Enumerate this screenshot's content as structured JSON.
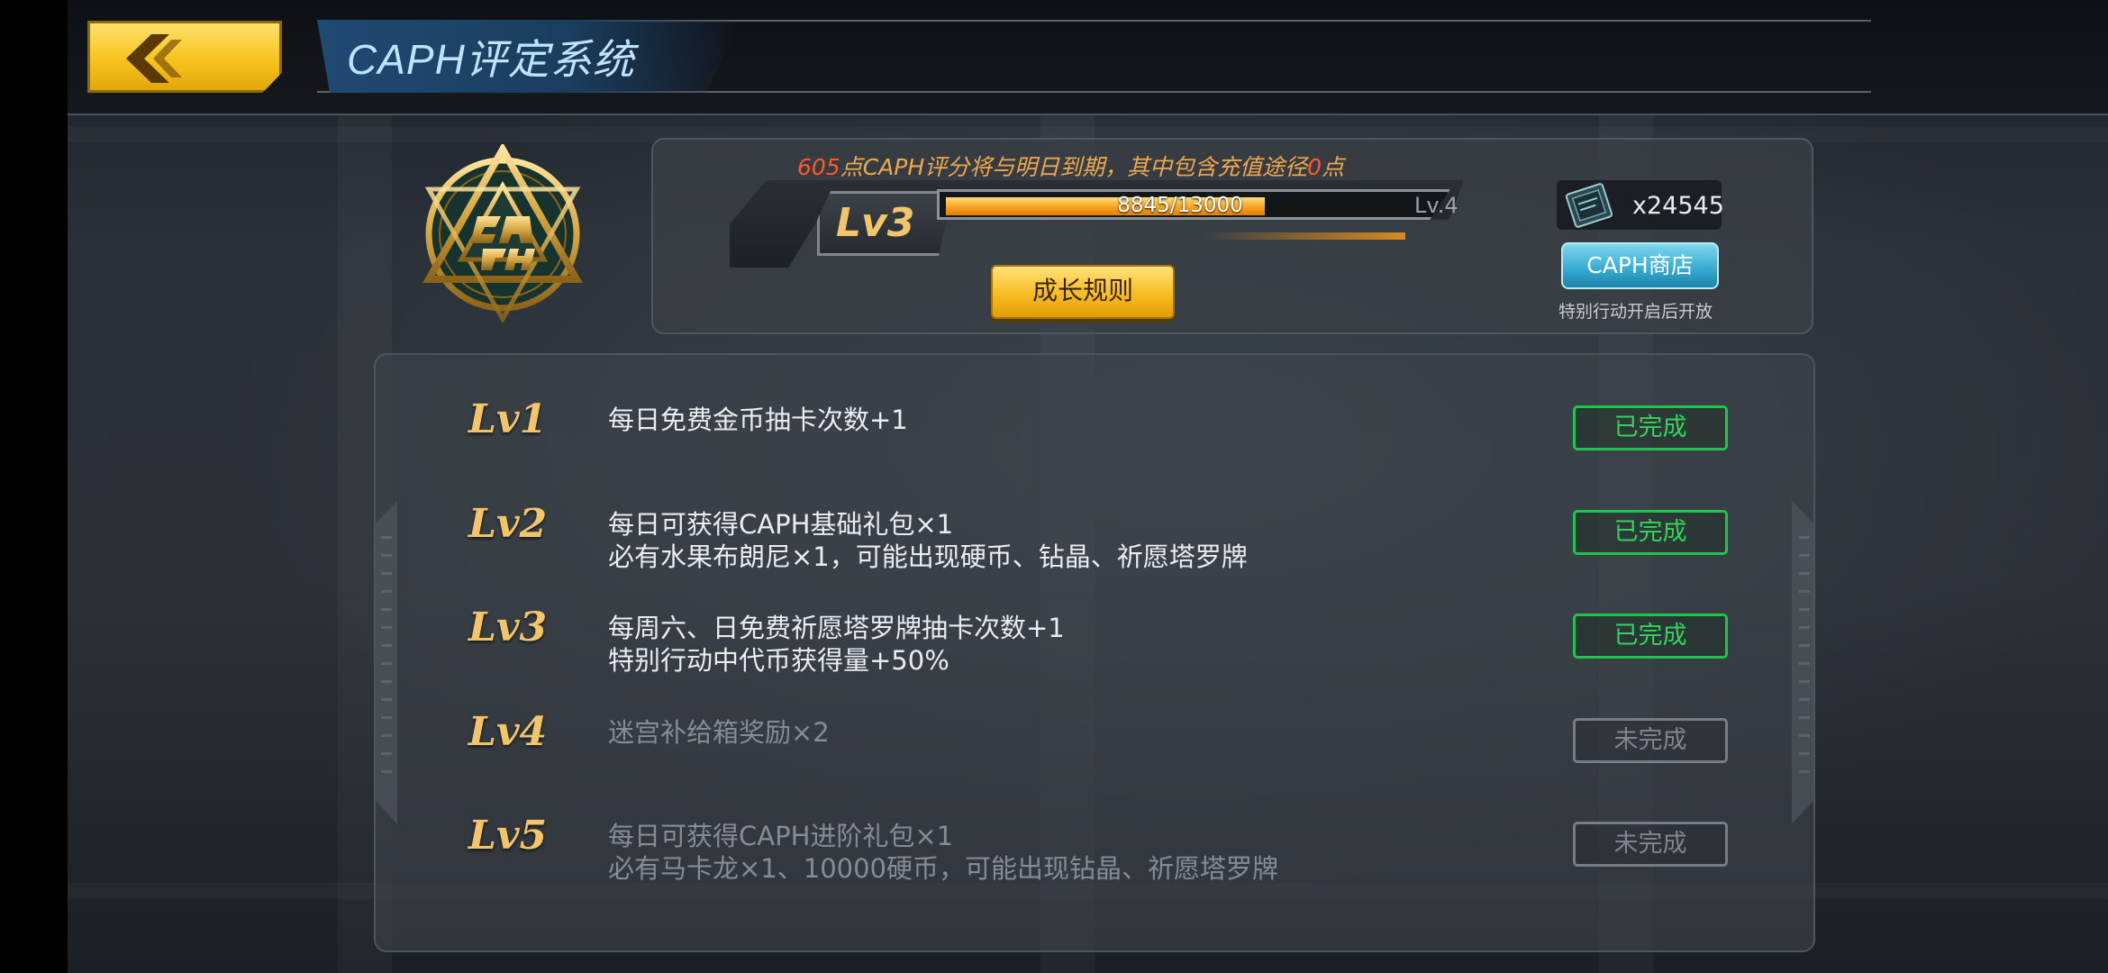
{
  "header": {
    "title": "CAPH评定系统"
  },
  "status": {
    "expire_points": "605",
    "expire_middle": "点CAPH评分将与明日到期，其中包含充值途径",
    "expire_recharge": "0",
    "expire_unit": "点",
    "current_level": "Lv3",
    "progress_text": "8845/13000",
    "progress_fraction": 0.68,
    "next_level": "Lv.4",
    "growth_rules_label": "成长规则",
    "currency_count": "x24545",
    "shop_label": "CAPH商店",
    "shop_hint": "特别行动开启后开放"
  },
  "levels": [
    {
      "label": "Lv1",
      "line1": "每日免费金币抽卡次数+1",
      "line2": "",
      "status": "已完成"
    },
    {
      "label": "Lv2",
      "line1": "每日可获得CAPH基础礼包×1",
      "line2": "必有水果布朗尼×1，可能出现硬币、钻晶、祈愿塔罗牌",
      "status": "已完成"
    },
    {
      "label": "Lv3",
      "line1": "每周六、日免费祈愿塔罗牌抽卡次数+1",
      "line2": "特别行动中代币获得量+50%",
      "status": "已完成"
    },
    {
      "label": "Lv4",
      "line1": "迷宫补给箱奖励×2",
      "line2": "",
      "status": "未完成"
    },
    {
      "label": "Lv5",
      "line1": "每日可获得CAPH进阶礼包×1",
      "line2": "必有马卡龙×1、10000硬币，可能出现钻晶、祈愿塔罗牌",
      "status": "未完成"
    }
  ],
  "colors": {
    "accent_gold": "#f3c56a",
    "done_green": "#31d659",
    "todo_gray": "#7f868d",
    "title_blue": "#bfe3ff",
    "notice_orange": "#f0a84e",
    "notice_red": "#ff5a28"
  },
  "icons": {
    "back": "chevron-left-icon",
    "emblem": "caph-emblem",
    "currency": "caph-ticket-icon"
  }
}
